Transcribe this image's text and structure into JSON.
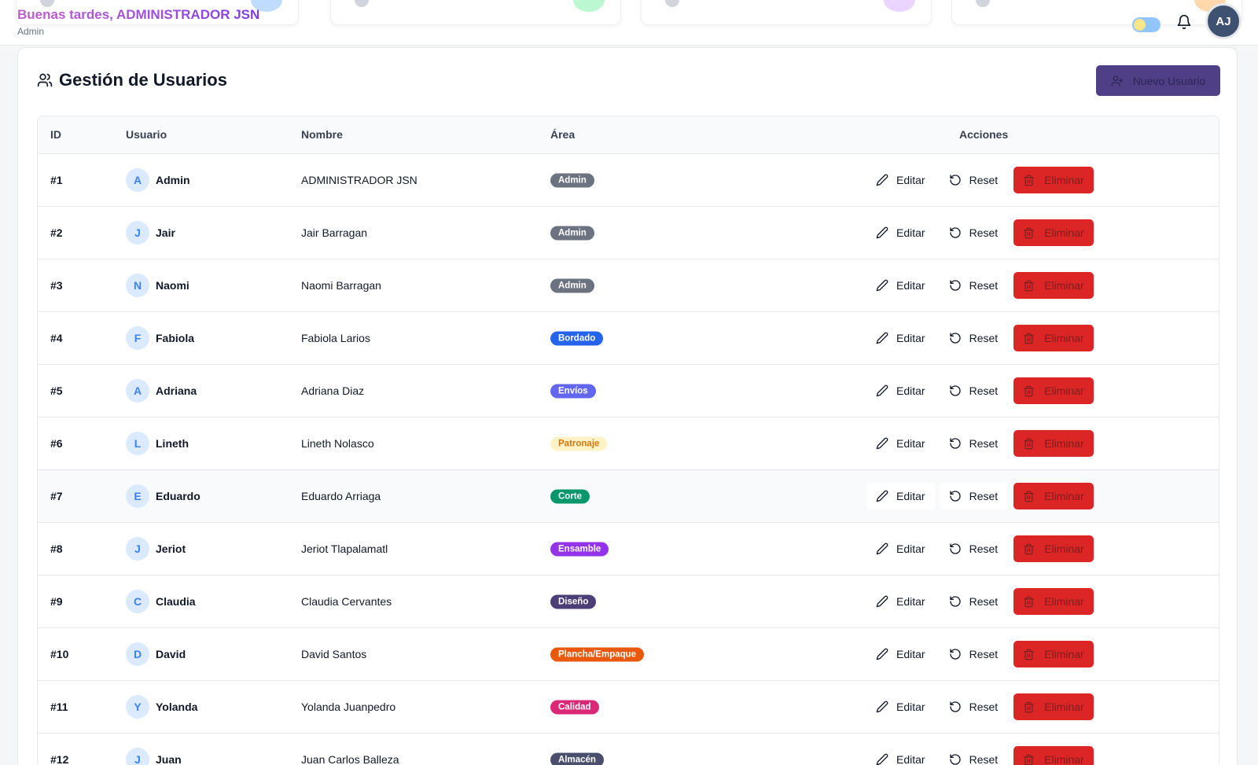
{
  "header": {
    "greeting": "Buenas tardes, ADMINISTRADOR JSN",
    "role": "Admin",
    "avatar_initials": "AJ"
  },
  "panel": {
    "title": "Gestión de Usuarios",
    "new_user_label": "Nuevo Usuario"
  },
  "table": {
    "headers": {
      "id": "ID",
      "user": "Usuario",
      "name": "Nombre",
      "area": "Área",
      "actions": "Acciones"
    },
    "action_labels": {
      "edit": "Editar",
      "reset": "Reset",
      "delete": "Eliminar"
    },
    "rows": [
      {
        "id": "#1",
        "initial": "A",
        "user": "Admin",
        "name": "ADMINISTRADOR JSN",
        "area": "Admin",
        "area_color": "#6b7280",
        "area_text": "#ffffff"
      },
      {
        "id": "#2",
        "initial": "J",
        "user": "Jair",
        "name": "Jair Barragan",
        "area": "Admin",
        "area_color": "#6b7280",
        "area_text": "#ffffff"
      },
      {
        "id": "#3",
        "initial": "N",
        "user": "Naomi",
        "name": "Naomi Barragan",
        "area": "Admin",
        "area_color": "#6b7280",
        "area_text": "#ffffff"
      },
      {
        "id": "#4",
        "initial": "F",
        "user": "Fabiola",
        "name": "Fabiola Larios",
        "area": "Bordado",
        "area_color": "#2563eb",
        "area_text": "#ffffff"
      },
      {
        "id": "#5",
        "initial": "A",
        "user": "Adriana",
        "name": "Adriana Diaz",
        "area": "Envíos",
        "area_color": "#6366f1",
        "area_text": "#ffffff"
      },
      {
        "id": "#6",
        "initial": "L",
        "user": "Lineth",
        "name": "Lineth Nolasco",
        "area": "Patronaje",
        "area_color": "#fef3c7",
        "area_text": "#d97706"
      },
      {
        "id": "#7",
        "initial": "E",
        "user": "Eduardo",
        "name": "Eduardo Arriaga",
        "area": "Corte",
        "area_color": "#059669",
        "area_text": "#ffffff"
      },
      {
        "id": "#8",
        "initial": "J",
        "user": "Jeriot",
        "name": "Jeriot Tlapalamatl",
        "area": "Ensamble",
        "area_color": "#9333ea",
        "area_text": "#ffffff"
      },
      {
        "id": "#9",
        "initial": "C",
        "user": "Claudia",
        "name": "Claudia Cervantes",
        "area": "Diseño",
        "area_color": "#4c3f77",
        "area_text": "#ffffff"
      },
      {
        "id": "#10",
        "initial": "D",
        "user": "David",
        "name": "David Santos",
        "area": "Plancha/Empaque",
        "area_color": "#ea580c",
        "area_text": "#ffffff"
      },
      {
        "id": "#11",
        "initial": "Y",
        "user": "Yolanda",
        "name": "Yolanda Juanpedro",
        "area": "Calidad",
        "area_color": "#db2777",
        "area_text": "#ffffff"
      },
      {
        "id": "#12",
        "initial": "J",
        "user": "Juan",
        "name": "Juan Carlos Balleza",
        "area": "Almacén",
        "area_color": "#4b4f6e",
        "area_text": "#ffffff"
      }
    ]
  },
  "colors": {
    "primary": "#4f3f86",
    "danger": "#dc2626",
    "avatar": "#3f5170"
  }
}
